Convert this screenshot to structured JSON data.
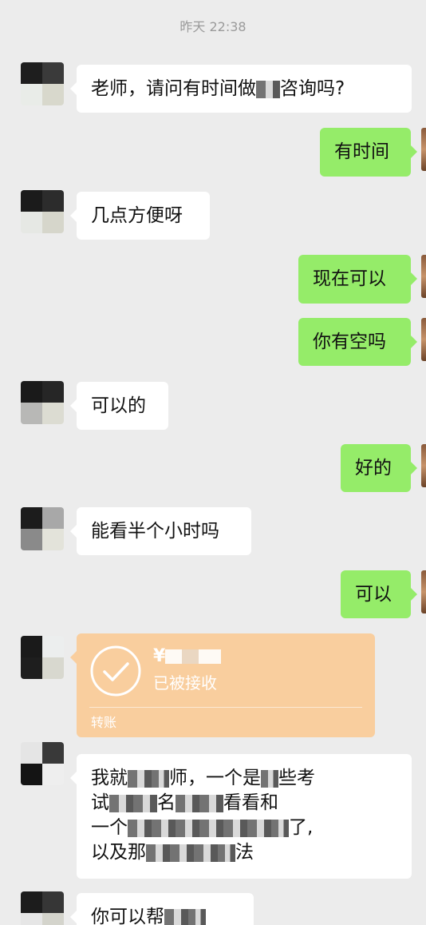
{
  "timestamp": "昨天 22:38",
  "messages": {
    "m1": {
      "pre": "老师，请问有时间做",
      "post": "咨询吗?"
    },
    "m2": "有时间",
    "m3": "几点方便呀",
    "m4": "现在可以",
    "m5": "你有空吗",
    "m6": "可以的",
    "m7": "好的",
    "m8": "能看半个小时吗",
    "m9": "可以",
    "transfer": {
      "amount_prefix": "¥",
      "status": "已被接收",
      "type_label": "转账"
    },
    "m10": {
      "line1_a": "我就",
      "line1_b": "师，一个是",
      "line1_c": "些考",
      "line2_a": "试",
      "line2_b": "名",
      "line2_c": "看看和",
      "line3_a": "一个",
      "line3_b": "了,",
      "line4_a": "以及那",
      "line4_b": "法"
    },
    "m11": {
      "pre": "你可以帮"
    }
  },
  "icons": {
    "avatar": "pixelated-avatar",
    "transfer": "check-circle-icon"
  },
  "colors": {
    "background": "#ececec",
    "bubble_left": "#ffffff",
    "bubble_right": "#95ec69",
    "transfer": "#f9ce9e"
  }
}
